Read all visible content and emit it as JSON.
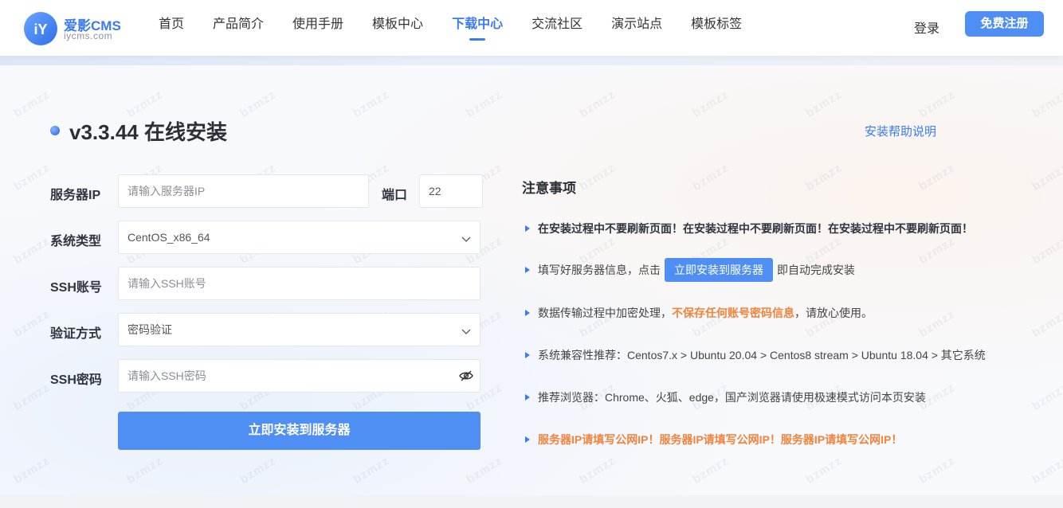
{
  "brand": {
    "name": "爱影CMS",
    "domain": "iycms.com",
    "logo_letters": "iY",
    "accent": "#3a7bf0"
  },
  "nav": {
    "items": [
      {
        "label": "首页"
      },
      {
        "label": "产品简介"
      },
      {
        "label": "使用手册"
      },
      {
        "label": "模板中心"
      },
      {
        "label": "下载中心",
        "active": true
      },
      {
        "label": "交流社区"
      },
      {
        "label": "演示站点"
      },
      {
        "label": "模板标签"
      }
    ],
    "login": "登录",
    "register": "免费注册"
  },
  "page": {
    "title": "v3.3.44 在线安装",
    "help_link": "安装帮助说明",
    "watermark": "bzmzz"
  },
  "form": {
    "server_ip": {
      "label": "服务器IP",
      "placeholder": "请输入服务器IP",
      "value": ""
    },
    "port": {
      "label": "端口",
      "value": "22"
    },
    "os_type": {
      "label": "系统类型",
      "selected": "CentOS_x86_64"
    },
    "ssh_account": {
      "label": "SSH账号",
      "placeholder": "请输入SSH账号",
      "value": ""
    },
    "auth_method": {
      "label": "验证方式",
      "selected": "密码验证"
    },
    "ssh_password": {
      "label": "SSH密码",
      "placeholder": "请输入SSH密码",
      "value": ""
    },
    "submit": "立即安装到服务器"
  },
  "notes": {
    "title": "注意事项",
    "items": {
      "n1": "在安装过程中不要刷新页面！在安装过程中不要刷新页面！在安装过程中不要刷新页面！",
      "n2_pre": "填写好服务器信息，点击",
      "n2_btn": "立即安装到服务器",
      "n2_post": "即自动完成安装",
      "n3_pre": "数据传输过程中加密处理，",
      "n3_highlight": "不保存任何账号密码信息",
      "n3_post": "，请放心使用。",
      "n4": "系统兼容性推荐：Centos7.x > Ubuntu 20.04 > Centos8 stream > Ubuntu 18.04 > 其它系统",
      "n5": "推荐浏览器：Chrome、火狐、edge，国产浏览器请使用极速模式访问本页安装",
      "n6": "服务器IP请填写公网IP！服务器IP请填写公网IP！服务器IP请填写公网IP！"
    },
    "highlight_color": "#f0843c"
  }
}
